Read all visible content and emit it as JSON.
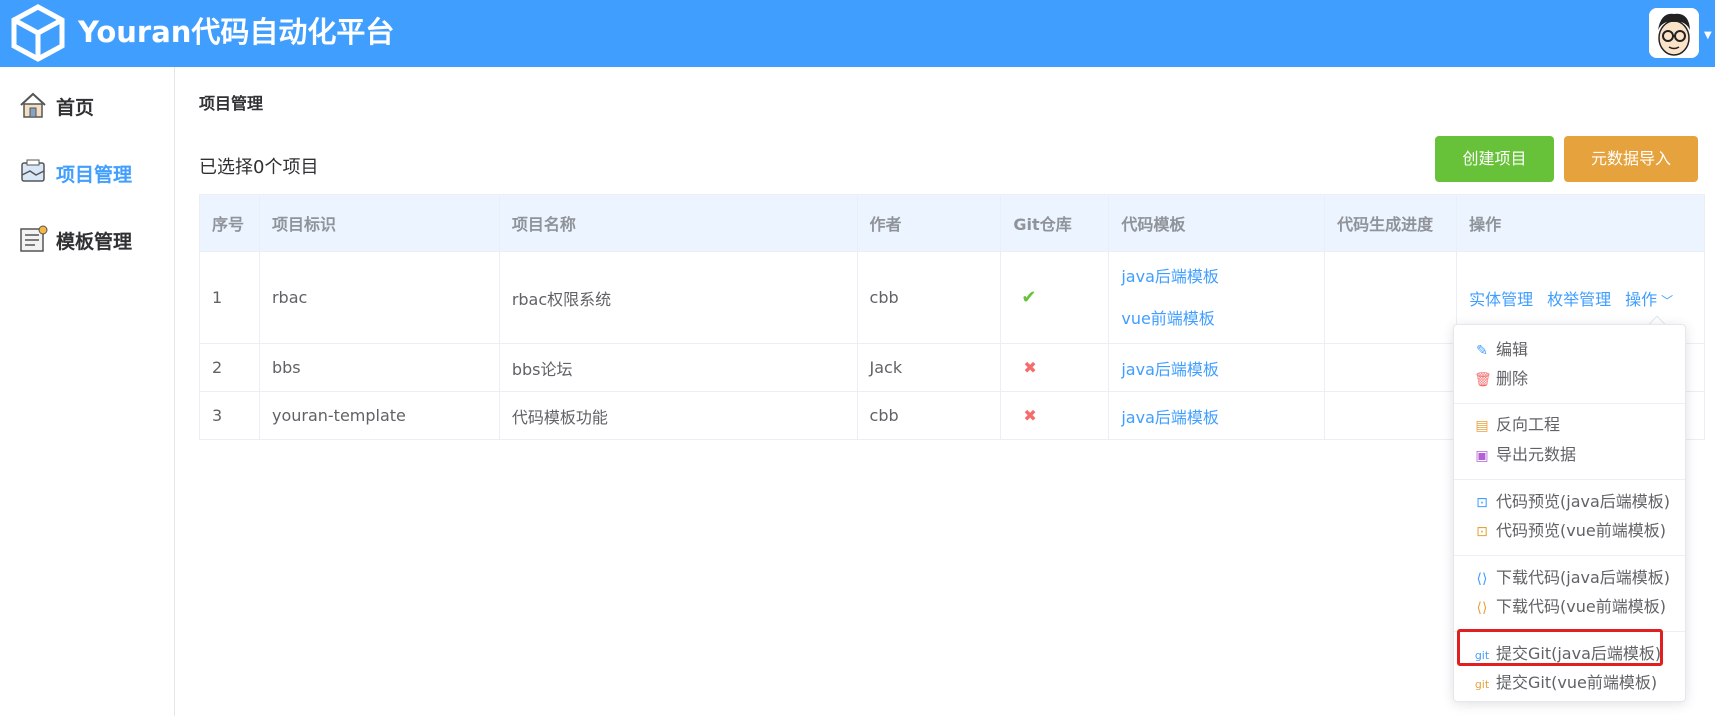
{
  "header": {
    "title": "Youran代码自动化平台"
  },
  "sidebar": {
    "items": [
      {
        "label": "首页",
        "icon": "home-icon"
      },
      {
        "label": "项目管理",
        "icon": "project-icon",
        "active": true
      },
      {
        "label": "模板管理",
        "icon": "template-icon"
      }
    ]
  },
  "breadcrumb": "项目管理",
  "selection_text": "已选择0个项目",
  "buttons": {
    "create": "创建项目",
    "import": "元数据导入"
  },
  "table": {
    "headers": [
      "序号",
      "项目标识",
      "项目名称",
      "作者",
      "Git仓库",
      "代码模板",
      "代码生成进度",
      "操作"
    ],
    "rows": [
      {
        "no": "1",
        "id": "rbac",
        "name": "rbac权限系统",
        "author": "cbb",
        "git": true,
        "templates": [
          "java后端模板",
          "vue前端模板"
        ]
      },
      {
        "no": "2",
        "id": "bbs",
        "name": "bbs论坛",
        "author": "Jack",
        "git": false,
        "templates": [
          "java后端模板"
        ]
      },
      {
        "no": "3",
        "id": "youran-template",
        "name": "代码模板功能",
        "author": "cbb",
        "git": false,
        "templates": [
          "java后端模板"
        ]
      }
    ],
    "row_actions": {
      "entity": "实体管理",
      "enum": "枚举管理",
      "more": "操作"
    }
  },
  "dropdown": {
    "items": [
      {
        "label": "编辑",
        "icon": "edit-icon",
        "color": "#409eff"
      },
      {
        "label": "删除",
        "icon": "delete-icon",
        "color": "#f56c6c"
      },
      {
        "label": "反向工程",
        "icon": "reverse-icon",
        "color": "#e6a23c"
      },
      {
        "label": "导出元数据",
        "icon": "export-icon",
        "color": "#b45fd6"
      },
      {
        "label": "代码预览(java后端模板)",
        "icon": "preview-icon",
        "color": "#409eff"
      },
      {
        "label": "代码预览(vue前端模板)",
        "icon": "preview-icon",
        "color": "#e6a23c"
      },
      {
        "label": "下载代码(java后端模板)",
        "icon": "download-icon",
        "color": "#409eff"
      },
      {
        "label": "下载代码(vue前端模板)",
        "icon": "download-icon",
        "color": "#e6a23c"
      },
      {
        "label": "提交Git(java后端模板)",
        "icon": "git-icon",
        "color": "#409eff"
      },
      {
        "label": "提交Git(vue前端模板)",
        "icon": "git-icon",
        "color": "#e6a23c"
      }
    ]
  }
}
